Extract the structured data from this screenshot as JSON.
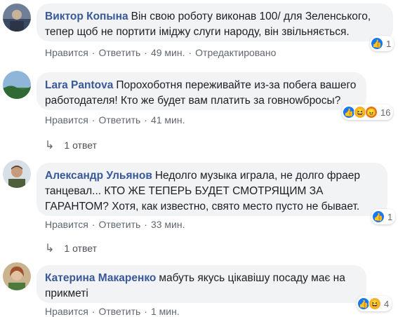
{
  "comments": [
    {
      "author": "Виктор Копына",
      "text_line1": "Він свою роботу виконав 100/ для Зеленського,",
      "text_line2": "тепер щоб не портити іміджу слуги народу, він звільняється.",
      "like": "Нравится",
      "reply": "Ответить",
      "time": "49 мин.",
      "edited": "Отредактировано",
      "reaction_count": "1",
      "reactions": [
        "like"
      ]
    },
    {
      "author": "Lara Pantova",
      "text_line1": "Порохоботня переживайте из-за побега вашего",
      "text_line2": "работодателя! Кто же будет вам платить за говнowбросы?",
      "like": "Нравится",
      "reply": "Ответить",
      "time": "41 мин.",
      "reaction_count": "16",
      "reactions": [
        "like",
        "haha",
        "angry"
      ],
      "replies_label": "1 ответ"
    },
    {
      "author": "Александр Ульянов",
      "text_line1": "Недолго музыка играла, не долго фраер",
      "text_line2": "танцевал... КТО ЖЕ ТЕПЕРЬ БУДЕТ СМОТРЯЩИМ ЗА",
      "text_line3": "ГАРАНТОМ? Хотя, как известно, свято место пусто не бывает.",
      "like": "Нравится",
      "reply": "Ответить",
      "time": "33 мин.",
      "reaction_count": "1",
      "reactions": [
        "like"
      ],
      "replies_label": "1 ответ"
    },
    {
      "author": "Катерина Макаренко",
      "text_line1": "мабуть якусь цікавішу посаду має на",
      "text_line2": "прикметі",
      "like": "Нравится",
      "reply": "Ответить",
      "time": "1 мин.",
      "reaction_count": "4",
      "reactions": [
        "like",
        "haha"
      ]
    }
  ],
  "colors": {
    "author": "#385898",
    "bubble": "#f2f3f5",
    "meta": "#606770",
    "like": "#1877f2"
  }
}
